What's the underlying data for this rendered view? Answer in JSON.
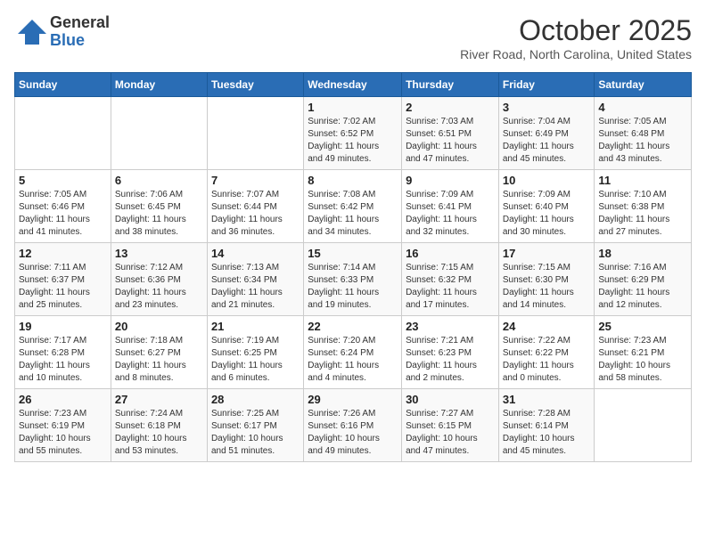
{
  "logo": {
    "general": "General",
    "blue": "Blue"
  },
  "header": {
    "month": "October 2025",
    "location": "River Road, North Carolina, United States"
  },
  "days_of_week": [
    "Sunday",
    "Monday",
    "Tuesday",
    "Wednesday",
    "Thursday",
    "Friday",
    "Saturday"
  ],
  "weeks": [
    [
      {
        "day": "",
        "info": ""
      },
      {
        "day": "",
        "info": ""
      },
      {
        "day": "",
        "info": ""
      },
      {
        "day": "1",
        "info": "Sunrise: 7:02 AM\nSunset: 6:52 PM\nDaylight: 11 hours\nand 49 minutes."
      },
      {
        "day": "2",
        "info": "Sunrise: 7:03 AM\nSunset: 6:51 PM\nDaylight: 11 hours\nand 47 minutes."
      },
      {
        "day": "3",
        "info": "Sunrise: 7:04 AM\nSunset: 6:49 PM\nDaylight: 11 hours\nand 45 minutes."
      },
      {
        "day": "4",
        "info": "Sunrise: 7:05 AM\nSunset: 6:48 PM\nDaylight: 11 hours\nand 43 minutes."
      }
    ],
    [
      {
        "day": "5",
        "info": "Sunrise: 7:05 AM\nSunset: 6:46 PM\nDaylight: 11 hours\nand 41 minutes."
      },
      {
        "day": "6",
        "info": "Sunrise: 7:06 AM\nSunset: 6:45 PM\nDaylight: 11 hours\nand 38 minutes."
      },
      {
        "day": "7",
        "info": "Sunrise: 7:07 AM\nSunset: 6:44 PM\nDaylight: 11 hours\nand 36 minutes."
      },
      {
        "day": "8",
        "info": "Sunrise: 7:08 AM\nSunset: 6:42 PM\nDaylight: 11 hours\nand 34 minutes."
      },
      {
        "day": "9",
        "info": "Sunrise: 7:09 AM\nSunset: 6:41 PM\nDaylight: 11 hours\nand 32 minutes."
      },
      {
        "day": "10",
        "info": "Sunrise: 7:09 AM\nSunset: 6:40 PM\nDaylight: 11 hours\nand 30 minutes."
      },
      {
        "day": "11",
        "info": "Sunrise: 7:10 AM\nSunset: 6:38 PM\nDaylight: 11 hours\nand 27 minutes."
      }
    ],
    [
      {
        "day": "12",
        "info": "Sunrise: 7:11 AM\nSunset: 6:37 PM\nDaylight: 11 hours\nand 25 minutes."
      },
      {
        "day": "13",
        "info": "Sunrise: 7:12 AM\nSunset: 6:36 PM\nDaylight: 11 hours\nand 23 minutes."
      },
      {
        "day": "14",
        "info": "Sunrise: 7:13 AM\nSunset: 6:34 PM\nDaylight: 11 hours\nand 21 minutes."
      },
      {
        "day": "15",
        "info": "Sunrise: 7:14 AM\nSunset: 6:33 PM\nDaylight: 11 hours\nand 19 minutes."
      },
      {
        "day": "16",
        "info": "Sunrise: 7:15 AM\nSunset: 6:32 PM\nDaylight: 11 hours\nand 17 minutes."
      },
      {
        "day": "17",
        "info": "Sunrise: 7:15 AM\nSunset: 6:30 PM\nDaylight: 11 hours\nand 14 minutes."
      },
      {
        "day": "18",
        "info": "Sunrise: 7:16 AM\nSunset: 6:29 PM\nDaylight: 11 hours\nand 12 minutes."
      }
    ],
    [
      {
        "day": "19",
        "info": "Sunrise: 7:17 AM\nSunset: 6:28 PM\nDaylight: 11 hours\nand 10 minutes."
      },
      {
        "day": "20",
        "info": "Sunrise: 7:18 AM\nSunset: 6:27 PM\nDaylight: 11 hours\nand 8 minutes."
      },
      {
        "day": "21",
        "info": "Sunrise: 7:19 AM\nSunset: 6:25 PM\nDaylight: 11 hours\nand 6 minutes."
      },
      {
        "day": "22",
        "info": "Sunrise: 7:20 AM\nSunset: 6:24 PM\nDaylight: 11 hours\nand 4 minutes."
      },
      {
        "day": "23",
        "info": "Sunrise: 7:21 AM\nSunset: 6:23 PM\nDaylight: 11 hours\nand 2 minutes."
      },
      {
        "day": "24",
        "info": "Sunrise: 7:22 AM\nSunset: 6:22 PM\nDaylight: 11 hours\nand 0 minutes."
      },
      {
        "day": "25",
        "info": "Sunrise: 7:23 AM\nSunset: 6:21 PM\nDaylight: 10 hours\nand 58 minutes."
      }
    ],
    [
      {
        "day": "26",
        "info": "Sunrise: 7:23 AM\nSunset: 6:19 PM\nDaylight: 10 hours\nand 55 minutes."
      },
      {
        "day": "27",
        "info": "Sunrise: 7:24 AM\nSunset: 6:18 PM\nDaylight: 10 hours\nand 53 minutes."
      },
      {
        "day": "28",
        "info": "Sunrise: 7:25 AM\nSunset: 6:17 PM\nDaylight: 10 hours\nand 51 minutes."
      },
      {
        "day": "29",
        "info": "Sunrise: 7:26 AM\nSunset: 6:16 PM\nDaylight: 10 hours\nand 49 minutes."
      },
      {
        "day": "30",
        "info": "Sunrise: 7:27 AM\nSunset: 6:15 PM\nDaylight: 10 hours\nand 47 minutes."
      },
      {
        "day": "31",
        "info": "Sunrise: 7:28 AM\nSunset: 6:14 PM\nDaylight: 10 hours\nand 45 minutes."
      },
      {
        "day": "",
        "info": ""
      }
    ]
  ]
}
